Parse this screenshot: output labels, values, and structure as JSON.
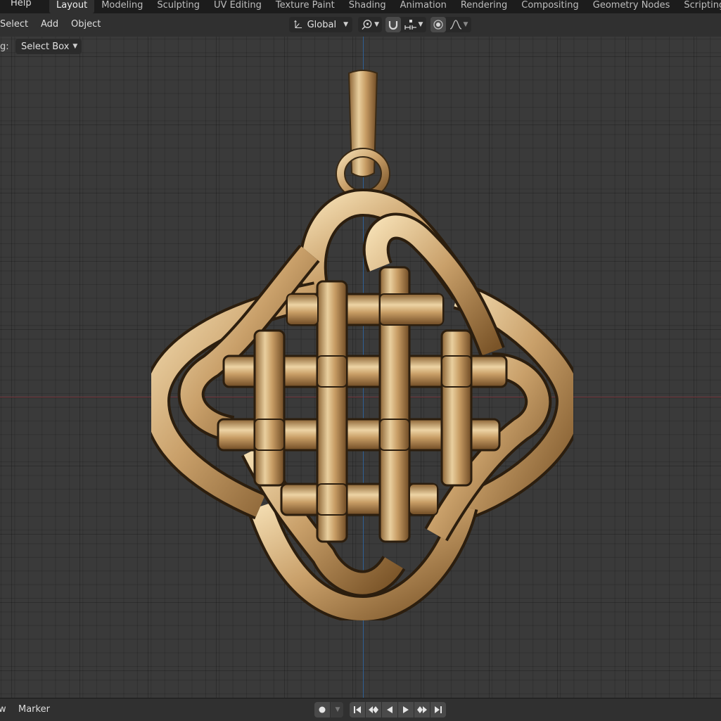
{
  "topbar": {
    "help_label": "Help",
    "tabs": [
      {
        "label": "Layout"
      },
      {
        "label": "Modeling"
      },
      {
        "label": "Sculpting"
      },
      {
        "label": "UV Editing"
      },
      {
        "label": "Texture Paint"
      },
      {
        "label": "Shading"
      },
      {
        "label": "Animation"
      },
      {
        "label": "Rendering"
      },
      {
        "label": "Compositing"
      },
      {
        "label": "Geometry Nodes"
      },
      {
        "label": "Scripting"
      }
    ],
    "active_tab": "Layout"
  },
  "header": {
    "menu_select": "Select",
    "menu_add": "Add",
    "menu_object": "Object",
    "transform_orientation": "Global",
    "icons": [
      "transform-orientation-icon",
      "pivot-point-icon",
      "snap-magnet-icon",
      "snap-target-icon",
      "proportional-editing-icon",
      "falloff-curve-icon"
    ]
  },
  "tool_settings": {
    "label": "g:",
    "select_mode": "Select Box"
  },
  "colors": {
    "viewport_bg": "#3a3a3a",
    "x_axis": "#7a3a40",
    "y_axis": "#2f5f93",
    "gold_light": "#f3dcb0",
    "gold_mid": "#c9a06a",
    "gold_dark": "#6e4a24"
  },
  "model": {
    "name": "celtic-knot-pendant"
  },
  "timeline": {
    "menu_view": "w",
    "menu_marker": "Marker",
    "icons": [
      "record-icon",
      "jump-start-icon",
      "prev-keyframe-icon",
      "play-reverse-icon",
      "play-icon",
      "next-keyframe-icon",
      "jump-end-icon"
    ]
  }
}
